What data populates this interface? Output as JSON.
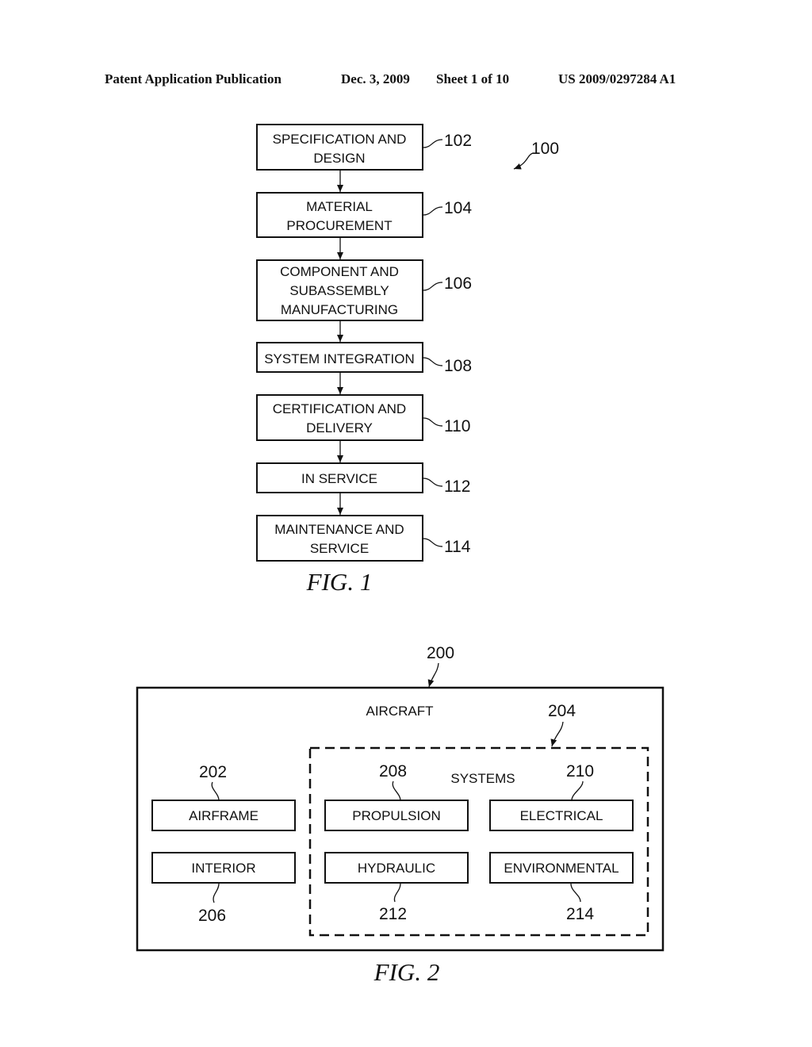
{
  "header": {
    "publication": "Patent Application Publication",
    "date": "Dec. 3, 2009",
    "sheet": "Sheet 1 of 10",
    "number": "US 2009/0297284 A1"
  },
  "fig1": {
    "caption": "FIG. 1",
    "ref": "100",
    "steps": [
      {
        "lines": [
          "SPECIFICATION AND",
          "DESIGN"
        ],
        "ref": "102"
      },
      {
        "lines": [
          "MATERIAL",
          "PROCUREMENT"
        ],
        "ref": "104"
      },
      {
        "lines": [
          "COMPONENT AND",
          "SUBASSEMBLY",
          "MANUFACTURING"
        ],
        "ref": "106"
      },
      {
        "lines": [
          "SYSTEM INTEGRATION"
        ],
        "ref": "108"
      },
      {
        "lines": [
          "CERTIFICATION AND",
          "DELIVERY"
        ],
        "ref": "110"
      },
      {
        "lines": [
          "IN SERVICE"
        ],
        "ref": "112"
      },
      {
        "lines": [
          "MAINTENANCE AND",
          "SERVICE"
        ],
        "ref": "114"
      }
    ]
  },
  "fig2": {
    "caption": "FIG. 2",
    "aircraft": {
      "label": "AIRCRAFT",
      "ref": "200"
    },
    "systems": {
      "label": "SYSTEMS",
      "ref": "204"
    },
    "airframe": {
      "label": "AIRFRAME",
      "ref": "202"
    },
    "interior": {
      "label": "INTERIOR",
      "ref": "206"
    },
    "propulsion": {
      "label": "PROPULSION",
      "ref": "208"
    },
    "electrical": {
      "label": "ELECTRICAL",
      "ref": "210"
    },
    "hydraulic": {
      "label": "HYDRAULIC",
      "ref": "212"
    },
    "environmental": {
      "label": "ENVIRONMENTAL",
      "ref": "214"
    }
  }
}
